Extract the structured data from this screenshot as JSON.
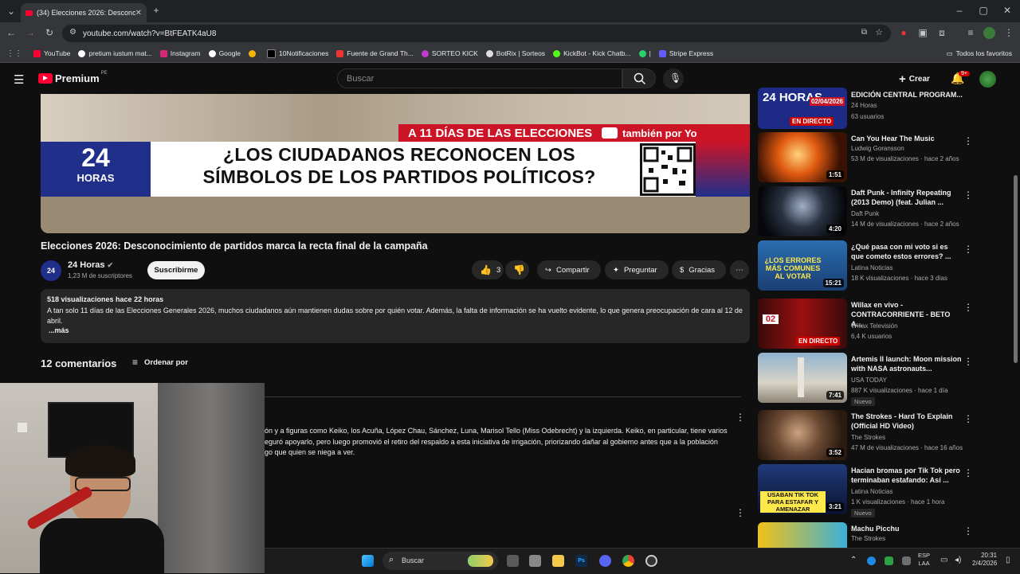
{
  "browser": {
    "tab_title": "(34) Elecciones 2026: Desconoc",
    "url": "youtube.com/watch?v=BtFEATK4aU8",
    "bookmarks": [
      "YouTube",
      "pretium iustum mat...",
      "Instagram",
      "Google",
      "",
      "10Notificaciones",
      "Fuente de Grand Th...",
      "SORTEO KICK",
      "BotRix | Sorteos",
      "KickBot - Kick Chatb...",
      "|",
      "Stripe Express"
    ],
    "all_favorites": "Todos los favoritos"
  },
  "yt_header": {
    "logo": "Premium",
    "region": "PE",
    "search_placeholder": "Buscar",
    "create_label": "Crear",
    "notif_count": "9+"
  },
  "video": {
    "banner_red": "A 11 DÍAS DE LAS ELECCIONES",
    "banner_side": "también por Yo",
    "logo_num": "24",
    "logo_word": "HORAS",
    "banner_question_1": "¿LOS CIUDADANOS RECONOCEN LOS",
    "banner_question_2": "SÍMBOLOS DE LOS PARTIDOS POLÍTICOS?",
    "title": "Elecciones 2026: Desconocimiento de partidos marca la recta final de la campaña",
    "channel": "24 Horas",
    "subscribers": "1,23 M de suscriptores",
    "subscribe": "Suscribirme",
    "likes": "3",
    "share": "Compartir",
    "ask": "Preguntar",
    "thanks": "Gracias"
  },
  "description": {
    "stats": "518 visualizaciones  hace 22 horas",
    "text": "A tan solo 11 días de las Elecciones Generales 2026, muchos ciudadanos aún mantienen dudas sobre por quién votar. Además, la falta de información se ha vuelto evidente, lo que genera preocupación de cara al 12 de abril.",
    "more": "...más"
  },
  "comments": {
    "count_label": "12 comentarios",
    "sort_label": "Ordenar por",
    "comment_line1": "ón y a figuras como Keiko, los Acuña, López Chau, Sánchez, Luna, Marisol Tello (Miss Odebrecht) y la izquierda. Keiko, en particular, tiene varios",
    "comment_line2": "eguró apoyarlo, pero luego promovió el retiro del respaldo a esta iniciativa de irrigación, priorizando dañar al gobierno antes que a la población",
    "comment_line3": "go que quien se niega a ver."
  },
  "sidebar": [
    {
      "title": "EDICIÓN CENTRAL PROGRAM...",
      "channel": "24 Horas",
      "meta": "63 usuarios",
      "badge": "EN DIRECTO",
      "thumb_text": "02/04/2026",
      "thumb_top": "24 HORAS"
    },
    {
      "title": "Can You Hear The Music",
      "channel": "Ludwig Goransson",
      "meta": "53 M de visualizaciones · hace 2 años",
      "duration": "1:51"
    },
    {
      "title": "Daft Punk - Infinity Repeating (2013 Demo) (feat. Julian ...",
      "channel": "Daft Punk",
      "meta": "14 M de visualizaciones · hace 2 años",
      "duration": "4:20"
    },
    {
      "title": "¿Qué pasa con mi voto si es que cometo estos errores? ...",
      "channel": "Latina Noticias",
      "meta": "18 K visualizaciones · hace 3 días",
      "duration": "15:21",
      "thumb_text": "¿LOS ERRORES MÁS COMUNES AL VOTAR"
    },
    {
      "title": "Willax en vivo - CONTRACORRIENTE - BETO A...",
      "channel": "Willax Televisión",
      "meta": "6,4 K usuarios",
      "badge": "EN DIRECTO",
      "thumb_text": "02"
    },
    {
      "title": "Artemis II launch: Moon mission with NASA astronauts...",
      "channel": "USA TODAY",
      "meta": "887 K visualizaciones · hace 1 día",
      "duration": "7:41",
      "new": "Nuevo"
    },
    {
      "title": "The Strokes - Hard To Explain (Official HD Video)",
      "channel": "The Strokes",
      "meta": "47 M de visualizaciones · hace 16 años",
      "duration": "3:52"
    },
    {
      "title": "Hacian bromas por Tik Tok pero terminaban estafando: Así ...",
      "channel": "Latina Noticias",
      "meta": "1 K visualizaciones · hace 1 hora",
      "duration": "3:21",
      "new": "Nuevo",
      "thumb_text": "USABAN TIK TOK PARA ESTAFAR Y AMENAZAR"
    },
    {
      "title": "Machu Picchu",
      "channel": "The Strokes",
      "meta": ""
    }
  ],
  "taskbar": {
    "search": "Buscar",
    "lang_1": "ESP",
    "lang_2": "LAA",
    "time": "20:31",
    "date": "2/4/2026"
  },
  "colors": {
    "yt_red": "#ff0033",
    "brand_blue": "#1f2f8a",
    "banner_red": "#cc1427"
  }
}
